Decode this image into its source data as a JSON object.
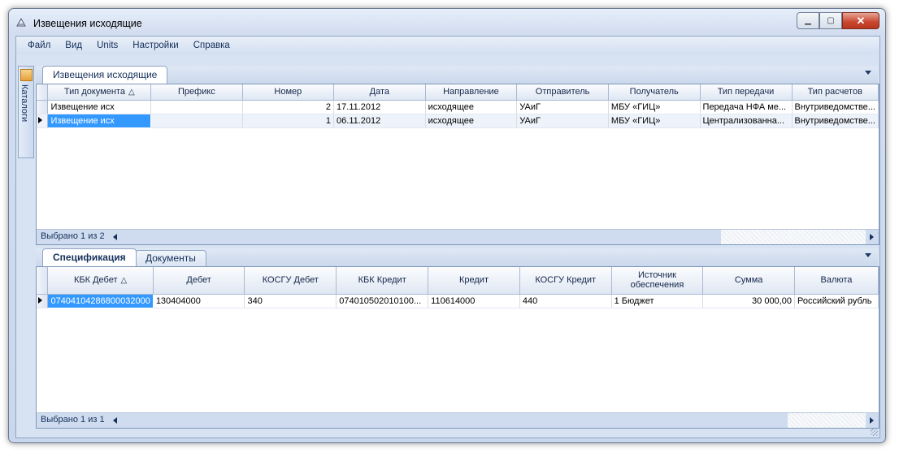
{
  "window": {
    "title": "Извещения исходящие"
  },
  "menu": [
    "Файл",
    "Вид",
    "Units",
    "Настройки",
    "Справка"
  ],
  "sidebar": {
    "label": "Каталоги"
  },
  "top_panel": {
    "tab_label": "Извещения исходящие",
    "columns": [
      "Тип документа",
      "Префикс",
      "Номер",
      "Дата",
      "Направление",
      "Отправитель",
      "Получатель",
      "Тип передачи",
      "Тип расчетов"
    ],
    "rows": [
      [
        "Извещение исх",
        "",
        "2",
        "17.11.2012",
        "исходящее",
        "УАиГ",
        "МБУ «ГИЦ»",
        "Передача НФА ме...",
        "Внутриведомстве..."
      ],
      [
        "Извещение исх",
        "",
        "1",
        "06.11.2012",
        "исходящее",
        "УАиГ",
        "МБУ «ГИЦ»",
        "Централизованна...",
        "Внутриведомстве..."
      ]
    ],
    "footer": "Выбрано 1 из 2"
  },
  "bottom_panel": {
    "tabs": [
      "Спецификация",
      "Документы"
    ],
    "columns": [
      "КБК Дебет",
      "Дебет",
      "КОСГУ Дебет",
      "КБК Кредит",
      "Кредит",
      "КОСГУ Кредит",
      "Источник обеспечения",
      "Сумма",
      "Валюта"
    ],
    "rows": [
      [
        "07404104286800032000",
        "130404000",
        "340",
        "074010502010100...",
        "110614000",
        "440",
        "1 Бюджет",
        "30 000,00",
        "Российский рубль"
      ]
    ],
    "footer": "Выбрано 1 из 1"
  },
  "icons": [
    "app-icon",
    "catalog-icon",
    "minimize-icon",
    "maximize-icon",
    "close-icon",
    "dropdown-arrow-icon",
    "sort-asc-icon",
    "scroll-left-icon",
    "scroll-right-icon",
    "current-row-icon",
    "resize-grip-icon"
  ]
}
